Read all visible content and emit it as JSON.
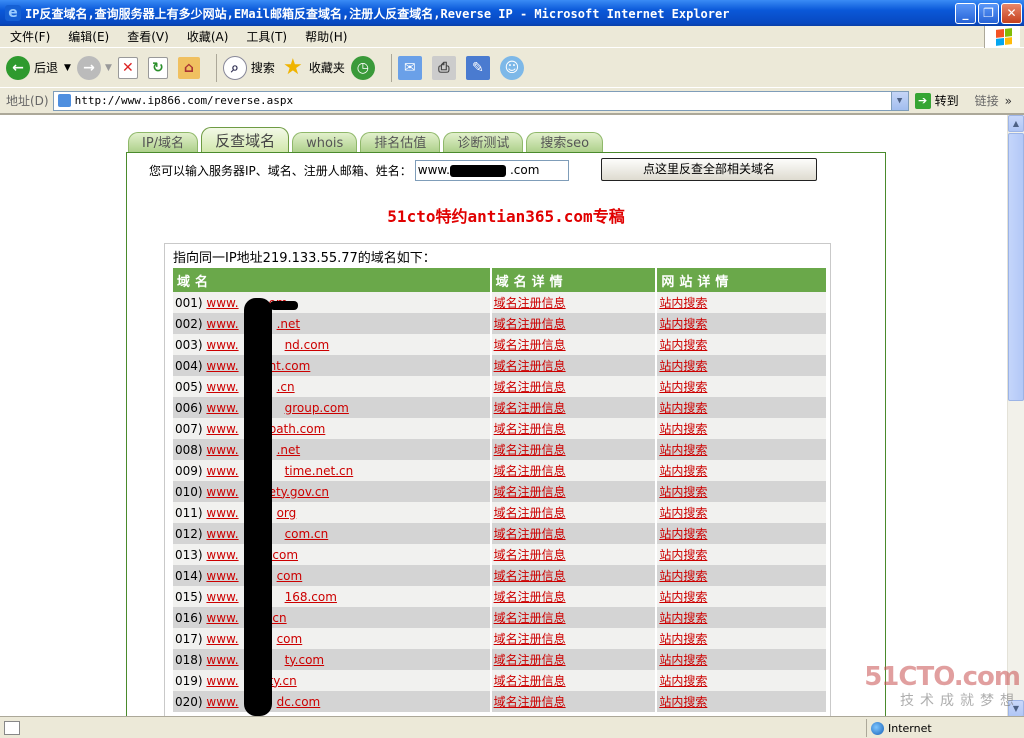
{
  "window": {
    "title": "IP反查域名,查询服务器上有多少网站,EMail邮箱反查域名,注册人反查域名,Reverse IP - Microsoft Internet Explorer",
    "buttons": {
      "minimize": "_",
      "maximize": "❐",
      "close": "✕"
    }
  },
  "menu": [
    "文件(F)",
    "编辑(E)",
    "查看(V)",
    "收藏(A)",
    "工具(T)",
    "帮助(H)"
  ],
  "toolbar": {
    "back": "后退",
    "search": "搜索",
    "favorites": "收藏夹"
  },
  "address": {
    "label": "地址(D)",
    "url": "http://www.ip866.com/reverse.aspx",
    "go": "转到",
    "links": "链接"
  },
  "tabs": [
    "IP/域名",
    "反查域名",
    "whois",
    "排名估值",
    "诊断测试",
    "搜索seo"
  ],
  "search": {
    "label": "您可以输入服务器IP、域名、注册人邮箱、姓名：",
    "value": "www.",
    "value_suffix": ".com",
    "button": "点这里反查全部相关域名"
  },
  "promo": "51cto特约antian365.com专稿",
  "results": {
    "heading": "指向同一IP地址219.133.55.77的域名如下：",
    "columns": [
      "域名",
      "域名详情",
      "网站详情"
    ],
    "detail_link": "域名注册信息",
    "site_link": "站内搜索",
    "rows": [
      {
        "num": "001)",
        "prefix": "www.",
        "suffix": "om"
      },
      {
        "num": "002)",
        "prefix": "www.",
        "suffix": ".net"
      },
      {
        "num": "003)",
        "prefix": "www.",
        "suffix": "nd.com"
      },
      {
        "num": "004)",
        "prefix": "www.",
        "suffix": "nt.com"
      },
      {
        "num": "005)",
        "prefix": "www.",
        "suffix": ".cn"
      },
      {
        "num": "006)",
        "prefix": "www.",
        "suffix": "group.com"
      },
      {
        "num": "007)",
        "prefix": "www.",
        "suffix": "path.com"
      },
      {
        "num": "008)",
        "prefix": "www.",
        "suffix": ".net"
      },
      {
        "num": "009)",
        "prefix": "www.",
        "suffix": "time.net.cn"
      },
      {
        "num": "010)",
        "prefix": "www.",
        "suffix": "ety.gov.cn"
      },
      {
        "num": "011)",
        "prefix": "www.",
        "suffix": "org"
      },
      {
        "num": "012)",
        "prefix": "www.",
        "suffix": "com.cn"
      },
      {
        "num": "013)",
        "prefix": "www.",
        "suffix": ".com"
      },
      {
        "num": "014)",
        "prefix": "www.",
        "suffix": "com"
      },
      {
        "num": "015)",
        "prefix": "www.",
        "suffix": "168.com"
      },
      {
        "num": "016)",
        "prefix": "www.",
        "suffix": ".cn"
      },
      {
        "num": "017)",
        "prefix": "www.",
        "suffix": "com"
      },
      {
        "num": "018)",
        "prefix": "www.",
        "suffix": "ty.com"
      },
      {
        "num": "019)",
        "prefix": "www.",
        "suffix": "ty.cn"
      },
      {
        "num": "020)",
        "prefix": "www.",
        "suffix": "dc.com"
      }
    ]
  },
  "status": {
    "zone": "Internet"
  },
  "watermark": {
    "brand": "51CTO.com",
    "slogan": "技术成就梦想"
  }
}
